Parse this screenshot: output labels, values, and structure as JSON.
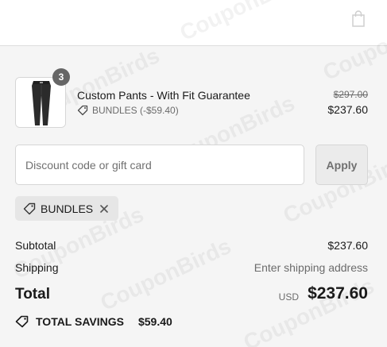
{
  "header": {
    "cart_icon": "shopping-bag-icon"
  },
  "watermark": {
    "text": "CouponBirds"
  },
  "line_item": {
    "quantity": "3",
    "title": "Custom Pants - With Fit Guarantee",
    "discount_label": "BUNDLES (-$59.40)",
    "price_original": "$297.00",
    "price_final": "$237.60",
    "image_icon": "pants-product-image"
  },
  "discount": {
    "placeholder": "Discount code or gift card",
    "value": "",
    "apply_label": "Apply",
    "applied_code": "BUNDLES"
  },
  "totals": {
    "subtotal_label": "Subtotal",
    "subtotal_value": "$237.60",
    "shipping_label": "Shipping",
    "shipping_value": "Enter shipping address",
    "total_label": "Total",
    "currency": "USD",
    "total_value": "$237.60",
    "savings_label": "TOTAL SAVINGS",
    "savings_value": "$59.40"
  },
  "colors": {
    "background": "#f5f5f5",
    "header": "#ffffff",
    "text": "#1a1a1a",
    "muted": "#6b6b6b",
    "badge": "#666666"
  }
}
